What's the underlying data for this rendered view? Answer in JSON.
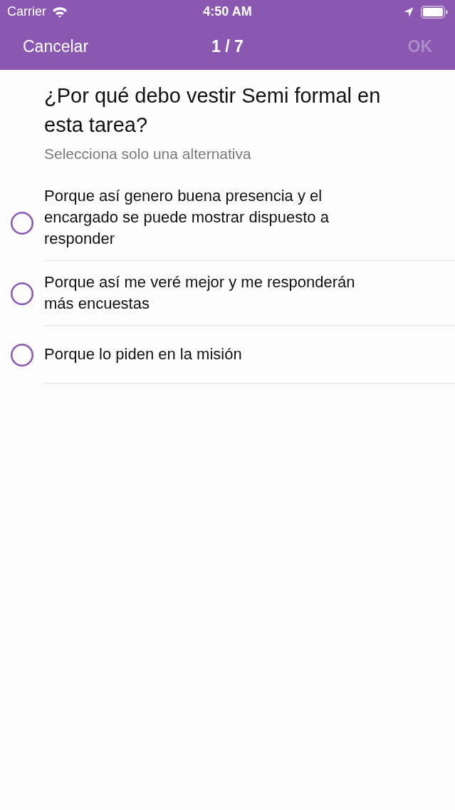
{
  "status_bar": {
    "carrier": "Carrier",
    "time": "4:50 AM"
  },
  "nav_bar": {
    "cancel": "Cancelar",
    "title": "1 / 7",
    "ok": {
      "label": "OK",
      "disabled": true
    }
  },
  "question": {
    "title": "¿Por qué debo vestir Semi formal en esta tarea?",
    "hint": "Selecciona solo una alternativa"
  },
  "options": [
    {
      "label": "Porque así genero buena presencia y el encargado se puede mostrar dispuesto a responder",
      "selected": false
    },
    {
      "label": "Porque así me veré mejor y me responderán más encuestas",
      "selected": false
    },
    {
      "label": "Porque lo piden en la misión",
      "selected": false
    }
  ]
}
